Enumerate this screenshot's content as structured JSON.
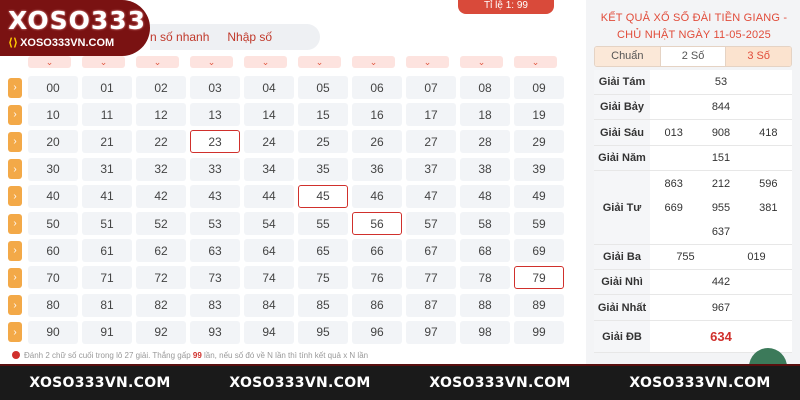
{
  "logo": {
    "main": "XOSO333",
    "sub": "XOSO333VN.COM",
    "sub_mark": "⟨⟩"
  },
  "tabs": [
    {
      "label": "n số nhanh"
    },
    {
      "label": "Nhập số"
    }
  ],
  "top_badge": "Tỉ lệ 1: 99",
  "column_chevron": "⌄",
  "row_arrow": "›",
  "number_grid": [
    [
      "00",
      "01",
      "02",
      "03",
      "04",
      "05",
      "06",
      "07",
      "08",
      "09"
    ],
    [
      "10",
      "11",
      "12",
      "13",
      "14",
      "15",
      "16",
      "17",
      "18",
      "19"
    ],
    [
      "20",
      "21",
      "22",
      "23",
      "24",
      "25",
      "26",
      "27",
      "28",
      "29"
    ],
    [
      "30",
      "31",
      "32",
      "33",
      "34",
      "35",
      "36",
      "37",
      "38",
      "39"
    ],
    [
      "40",
      "41",
      "42",
      "43",
      "44",
      "45",
      "46",
      "47",
      "48",
      "49"
    ],
    [
      "50",
      "51",
      "52",
      "53",
      "54",
      "55",
      "56",
      "57",
      "58",
      "59"
    ],
    [
      "60",
      "61",
      "62",
      "63",
      "64",
      "65",
      "66",
      "67",
      "68",
      "69"
    ],
    [
      "70",
      "71",
      "72",
      "73",
      "74",
      "75",
      "76",
      "77",
      "78",
      "79"
    ],
    [
      "80",
      "81",
      "82",
      "83",
      "84",
      "85",
      "86",
      "87",
      "88",
      "89"
    ],
    [
      "90",
      "91",
      "92",
      "93",
      "94",
      "95",
      "96",
      "97",
      "98",
      "99"
    ]
  ],
  "selected_numbers": [
    "23",
    "45",
    "56",
    "79"
  ],
  "footnote": {
    "prefix": "Đánh 2 chữ số cuối trong lô 27 giải. Thắng gấp ",
    "highlight": "99",
    "suffix": " lần, nếu số đó về N lần thì tính kết quả x N lần"
  },
  "results": {
    "title_line1": "KẾT QUẢ XỔ SỐ ĐÀI TIỀN GIANG -",
    "title_line2": "CHỦ NHẬT NGÀY 11-05-2025",
    "tabs": [
      "Chuẩn",
      "2 Số",
      "3 Số"
    ],
    "active_tab": "3 Số",
    "prizes": [
      {
        "label": "Giải Tám",
        "lines": [
          [
            "53"
          ]
        ]
      },
      {
        "label": "Giải Bảy",
        "lines": [
          [
            "844"
          ]
        ]
      },
      {
        "label": "Giải Sáu",
        "lines": [
          [
            "013",
            "908",
            "418"
          ]
        ]
      },
      {
        "label": "Giải Năm",
        "lines": [
          [
            "151"
          ]
        ]
      },
      {
        "label": "Giải Tư",
        "lines": [
          [
            "863",
            "212",
            "596"
          ],
          [
            "669",
            "955",
            "381"
          ],
          [
            "637"
          ]
        ]
      },
      {
        "label": "Giải Ba",
        "lines": [
          [
            "755",
            "019"
          ]
        ]
      },
      {
        "label": "Giải Nhì",
        "lines": [
          [
            "442"
          ]
        ]
      },
      {
        "label": "Giải Nhất",
        "lines": [
          [
            "967"
          ]
        ]
      },
      {
        "label": "Giải ĐB",
        "lines": [
          [
            "634"
          ]
        ],
        "special": true
      }
    ]
  },
  "footer": {
    "links": [
      "XOSO333VN.COM",
      "XOSO333VN.COM",
      "XOSO333VN.COM",
      "XOSO333VN.COM"
    ]
  },
  "colors": {
    "accent": "#d0302c",
    "brand": "#7a1212",
    "arrow": "#f3a948",
    "chevron_bg": "#fde3df",
    "active_tab": "#fbe3cf"
  }
}
